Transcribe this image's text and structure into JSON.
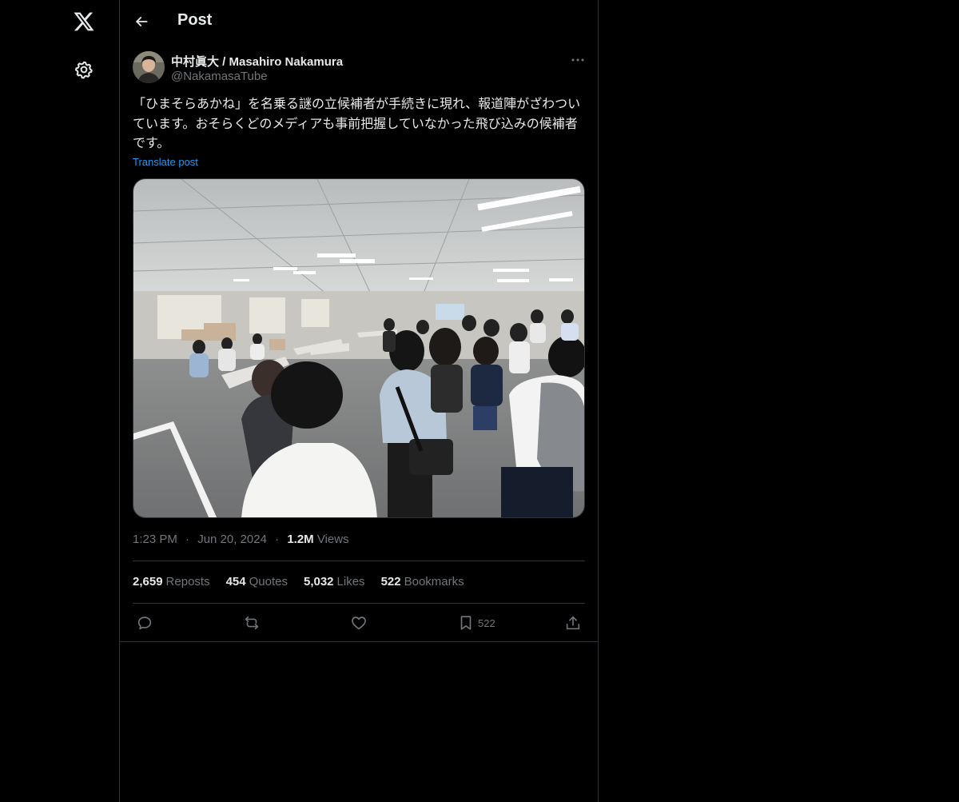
{
  "nav": {
    "logo_icon": "x-logo-icon",
    "settings_icon": "gear-icon"
  },
  "header": {
    "back_icon": "arrow-left-icon",
    "title": "Post"
  },
  "post": {
    "display_name": "中村眞大 / Masahiro Nakamura",
    "handle": "@NakamasaTube",
    "text": "「ひまそらあかね」を名乗る謎の立候補者が手続きに現れ、報道陣がざわついています。おそらくどのメディアも事前把握していなかった飛び込みの候補者です。",
    "translate_label": "Translate post",
    "time": "1:23 PM",
    "date": "Jun 20, 2024",
    "views_count": "1.2M",
    "views_label": "Views",
    "separator": "·"
  },
  "stats": {
    "reposts_count": "2,659",
    "reposts_label": "Reposts",
    "quotes_count": "454",
    "quotes_label": "Quotes",
    "likes_count": "5,032",
    "likes_label": "Likes",
    "bookmarks_count": "522",
    "bookmarks_label": "Bookmarks"
  },
  "actions": {
    "bookmark_count": "522"
  },
  "colors": {
    "background": "#000000",
    "text_primary": "#e7e9ea",
    "text_secondary": "#71767b",
    "link": "#1d9bf0",
    "border": "#2f3336"
  }
}
